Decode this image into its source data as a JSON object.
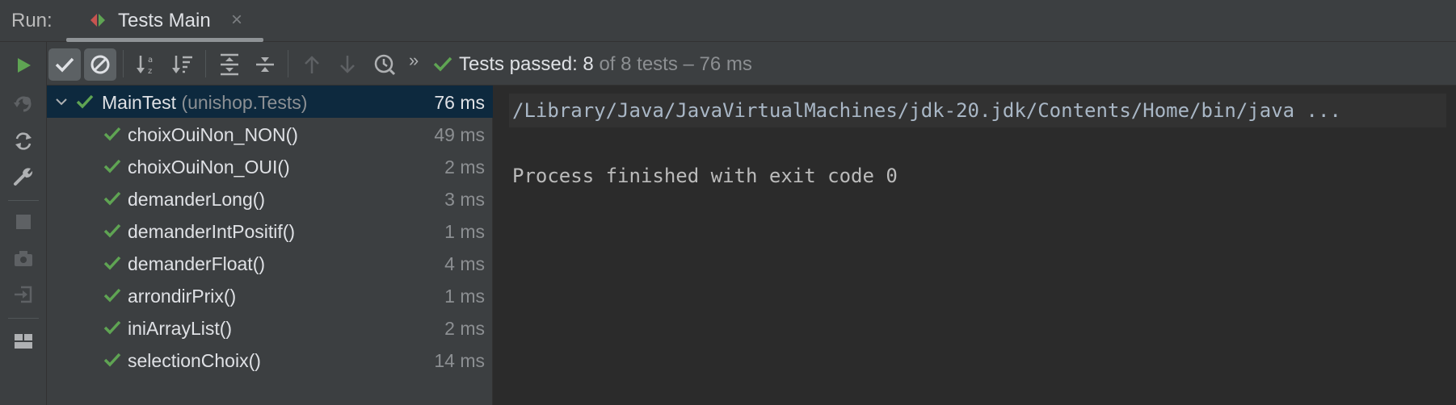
{
  "header": {
    "run_label": "Run:",
    "tab_title": "Tests Main",
    "tab_close": "×"
  },
  "toolbar": {
    "status_prefix": "Tests passed:",
    "passed": "8",
    "rest": "of 8 tests – 76 ms",
    "more": "»"
  },
  "tree": {
    "root": {
      "name": "MainTest",
      "package": "(unishop.Tests)",
      "time": "76 ms"
    },
    "tests": [
      {
        "name": "choixOuiNon_NON()",
        "time": "49 ms"
      },
      {
        "name": "choixOuiNon_OUI()",
        "time": "2 ms"
      },
      {
        "name": "demanderLong()",
        "time": "3 ms"
      },
      {
        "name": "demanderIntPositif()",
        "time": "1 ms"
      },
      {
        "name": "demanderFloat()",
        "time": "4 ms"
      },
      {
        "name": "arrondirPrix()",
        "time": "1 ms"
      },
      {
        "name": "iniArrayList()",
        "time": "2 ms"
      },
      {
        "name": "selectionChoix()",
        "time": "14 ms"
      }
    ]
  },
  "console": {
    "command": "/Library/Java/JavaVirtualMachines/jdk-20.jdk/Contents/Home/bin/java ...",
    "result": "Process finished with exit code 0"
  },
  "colors": {
    "pass_green": "#5fa453",
    "selected_row": "#0d293e",
    "panel": "#3c3f41",
    "console_bg": "#2b2b2b"
  }
}
